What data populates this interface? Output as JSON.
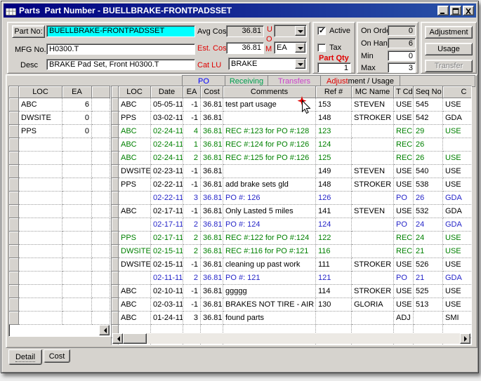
{
  "window": {
    "title": "Parts  Part Number - BUELLBRAKE-FRONTPADSSET"
  },
  "form": {
    "part_no": {
      "label": "Part No:",
      "value": "BUELLBRAKE-FRONTPADSSET"
    },
    "mfg_no": {
      "label": "MFG No.",
      "value": "H0300.T"
    },
    "desc": {
      "label": "Desc",
      "value": "BRAKE Pad Set, Front  H0300.T"
    },
    "avg_cost": {
      "label": "Avg Cost",
      "value": "36.81"
    },
    "est_cost": {
      "label": "Est. Cost",
      "value": "36.81"
    },
    "cat_lu": {
      "label": "Cat LU",
      "value": "BRAKE"
    },
    "uom": {
      "u": "U",
      "o": "O",
      "m": "M",
      "combo_top_value": "",
      "combo_bottom_value": "EA"
    },
    "active": {
      "label": "Active",
      "checked": true
    },
    "tax": {
      "label": "Tax",
      "checked": false
    },
    "part_qty": {
      "label": "Part Qty",
      "value": "1"
    },
    "on_order": {
      "label": "On Order",
      "value": "0"
    },
    "on_hand": {
      "label": "On Hand",
      "value": "6"
    },
    "min": {
      "label": "Min",
      "value": "0"
    },
    "max": {
      "label": "Max",
      "value": "3"
    },
    "buttons": {
      "adjustment": "Adjustment",
      "usage": "Usage",
      "transfer": "Transfer"
    }
  },
  "legend": {
    "po": "PO",
    "receiving": "Receiving",
    "transfers": "Transfers",
    "adjustment_red_part": "Adjust",
    "adjustment_black_part": "ment / Usage"
  },
  "colors": {
    "titlebar": "#000080",
    "highlight_cyan": "#00ffff",
    "legend_po_blue": "#0000ff",
    "legend_receiving_green": "#00a050",
    "legend_transfers_magenta": "#cc44cc",
    "legend_adjustment_red": "#e00000",
    "row_green": "#008000",
    "row_blue": "#2626c8"
  },
  "left_grid": {
    "headers": [
      "LOC",
      "EA"
    ],
    "rows": [
      {
        "loc": "ABC",
        "ea": "6"
      },
      {
        "loc": "DWSITE",
        "ea": "0"
      },
      {
        "loc": "PPS",
        "ea": "0"
      }
    ]
  },
  "main_grid": {
    "headers": [
      "LOC",
      "Date",
      "EA",
      "Cost",
      "Comments",
      "Ref #",
      "MC Name",
      "T Cd",
      "Seq No",
      "C"
    ],
    "rows": [
      {
        "loc": "ABC",
        "date": "05-05-11",
        "ea": "-1",
        "cost": "36.81",
        "comments": "test part usage",
        "ref": "153",
        "mc_name": "STEVEN",
        "t_cd": "USE",
        "seq_no": "545",
        "c": "USE",
        "type": "black"
      },
      {
        "loc": "PPS",
        "date": "03-02-11",
        "ea": "-1",
        "cost": "36.81",
        "comments": "",
        "ref": "148",
        "mc_name": "STROKER",
        "t_cd": "USE",
        "seq_no": "542",
        "c": "GDA",
        "type": "black"
      },
      {
        "loc": "ABC",
        "date": "02-24-11",
        "ea": "4",
        "cost": "36.81",
        "comments": "REC #:123 for PO #:128",
        "ref": "123",
        "mc_name": "",
        "t_cd": "REC",
        "seq_no": "29",
        "c": "USE",
        "type": "green"
      },
      {
        "loc": "ABC",
        "date": "02-24-11",
        "ea": "1",
        "cost": "36.81",
        "comments": "REC #:124 for PO #:126",
        "ref": "124",
        "mc_name": "",
        "t_cd": "REC",
        "seq_no": "26",
        "c": "",
        "type": "green"
      },
      {
        "loc": "ABC",
        "date": "02-24-11",
        "ea": "2",
        "cost": "36.81",
        "comments": "REC #:125 for PO #:126",
        "ref": "125",
        "mc_name": "",
        "t_cd": "REC",
        "seq_no": "26",
        "c": "USE",
        "type": "green"
      },
      {
        "loc": "DWSITE",
        "date": "02-23-11",
        "ea": "-1",
        "cost": "36.81",
        "comments": "",
        "ref": "149",
        "mc_name": "STEVEN",
        "t_cd": "USE",
        "seq_no": "540",
        "c": "USE",
        "type": "black"
      },
      {
        "loc": "PPS",
        "date": "02-22-11",
        "ea": "-1",
        "cost": "36.81",
        "comments": "add brake sets gld",
        "ref": "148",
        "mc_name": "STROKER",
        "t_cd": "USE",
        "seq_no": "538",
        "c": "USE",
        "type": "black"
      },
      {
        "loc": "",
        "date": "02-22-11",
        "ea": "3",
        "cost": "36.81",
        "comments": "PO #: 126",
        "ref": "126",
        "mc_name": "",
        "t_cd": "PO",
        "seq_no": "26",
        "c": "GDA",
        "type": "blue"
      },
      {
        "loc": "ABC",
        "date": "02-17-11",
        "ea": "-1",
        "cost": "36.81",
        "comments": "Only Lasted 5 miles",
        "ref": "141",
        "mc_name": "STEVEN",
        "t_cd": "USE",
        "seq_no": "532",
        "c": "GDA",
        "type": "black"
      },
      {
        "loc": "",
        "date": "02-17-11",
        "ea": "2",
        "cost": "36.81",
        "comments": "PO #: 124",
        "ref": "124",
        "mc_name": "",
        "t_cd": "PO",
        "seq_no": "24",
        "c": "GDA",
        "type": "blue"
      },
      {
        "loc": "PPS",
        "date": "02-17-11",
        "ea": "2",
        "cost": "36.81",
        "comments": "REC #:122 for PO #:124",
        "ref": "122",
        "mc_name": "",
        "t_cd": "REC",
        "seq_no": "24",
        "c": "USE",
        "type": "green"
      },
      {
        "loc": "DWSITE",
        "date": "02-15-11",
        "ea": "2",
        "cost": "36.81",
        "comments": "REC #:116 for PO #:121",
        "ref": "116",
        "mc_name": "",
        "t_cd": "REC",
        "seq_no": "21",
        "c": "USE",
        "type": "green"
      },
      {
        "loc": "DWSITE",
        "date": "02-15-11",
        "ea": "-1",
        "cost": "36.81",
        "comments": "cleaning up past work",
        "ref": "111",
        "mc_name": "STROKER",
        "t_cd": "USE",
        "seq_no": "526",
        "c": "USE",
        "type": "black"
      },
      {
        "loc": "",
        "date": "02-11-11",
        "ea": "2",
        "cost": "36.81",
        "comments": "PO #: 121",
        "ref": "121",
        "mc_name": "",
        "t_cd": "PO",
        "seq_no": "21",
        "c": "GDA",
        "type": "blue"
      },
      {
        "loc": "ABC",
        "date": "02-10-11",
        "ea": "-1",
        "cost": "36.81",
        "comments": "ggggg",
        "ref": "114",
        "mc_name": "STROKER",
        "t_cd": "USE",
        "seq_no": "525",
        "c": "USE",
        "type": "black"
      },
      {
        "loc": "ABC",
        "date": "02-03-11",
        "ea": "-1",
        "cost": "36.81",
        "comments": "BRAKES NOT TIRE - AIR",
        "ref": "130",
        "mc_name": "GLORIA",
        "t_cd": "USE",
        "seq_no": "513",
        "c": "USE",
        "type": "black"
      },
      {
        "loc": "ABC",
        "date": "01-24-11",
        "ea": "3",
        "cost": "36.81",
        "comments": "found parts",
        "ref": "",
        "mc_name": "",
        "t_cd": "ADJ",
        "seq_no": "",
        "c": "SMI",
        "type": "black"
      }
    ]
  },
  "tabs": {
    "detail": "Detail",
    "cost": "Cost"
  }
}
